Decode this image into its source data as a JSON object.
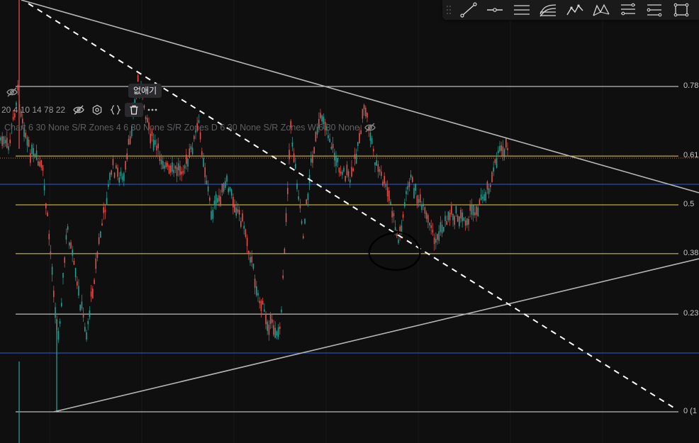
{
  "tooltip": {
    "text": "없애기"
  },
  "legend": {
    "values": "20 4 10 14 78 22",
    "icons": [
      "eye-off-icon",
      "settings-icon",
      "source-code-icon",
      "trash-icon",
      "more-icon"
    ]
  },
  "indicator": {
    "text": "Chart 6 30 None S/R Zones 4 6 30 None S/R Zones D 6 30 None S/R Zones W 6 30 None"
  },
  "price_axis": {
    "labels": [
      {
        "text": "0.78",
        "level": 0.786,
        "color": "#ffffff"
      },
      {
        "text": "0.61",
        "level": 0.618,
        "color": "#f7d64a"
      },
      {
        "text": "0.5",
        "level": 0.5,
        "color": "#f7d64a"
      },
      {
        "text": "0.38",
        "level": 0.382,
        "color": "#f7d64a"
      },
      {
        "text": "0.23",
        "level": 0.236,
        "color": "#ffffff"
      },
      {
        "text": "0 (1",
        "level": 0,
        "color": "#ffffff"
      }
    ]
  },
  "fib_colors": {
    "white": "#e6e6e6",
    "yellow": "#e8d24a",
    "blue": "#2d5bd6"
  },
  "toolbar": {
    "tools": [
      "trend-line-icon",
      "horizontal-ray-icon",
      "parallel-channel-icon",
      "regression-channel-icon",
      "zigzag-pattern-icon",
      "xabcd-pattern-icon",
      "fib-retracement-icon",
      "fib-extension-icon",
      "rectangle-icon"
    ]
  }
}
